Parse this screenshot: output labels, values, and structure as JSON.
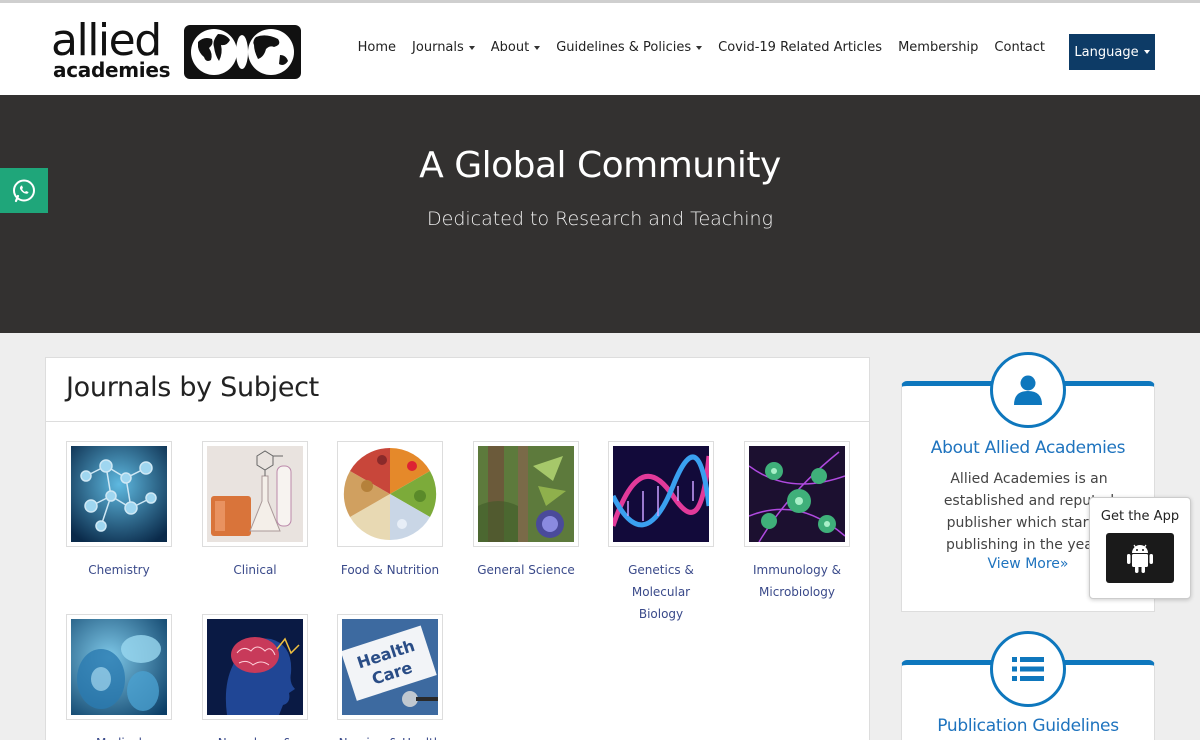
{
  "brand": {
    "logo_word1": "allied",
    "logo_word2": "academies"
  },
  "nav": {
    "items": [
      {
        "label": "Home",
        "dropdown": false
      },
      {
        "label": "Journals",
        "dropdown": true
      },
      {
        "label": "About",
        "dropdown": true
      },
      {
        "label": "Guidelines & Policies",
        "dropdown": true
      },
      {
        "label": "Covid-19 Related Articles",
        "dropdown": false
      },
      {
        "label": "Membership",
        "dropdown": false
      },
      {
        "label": "Contact",
        "dropdown": false
      }
    ],
    "language_label": "Language"
  },
  "hero": {
    "title": "A Global Community",
    "subtitle": "Dedicated to Research and Teaching"
  },
  "subjects": {
    "heading": "Journals by Subject",
    "items": [
      {
        "label": "Chemistry"
      },
      {
        "label": "Clinical"
      },
      {
        "label": "Food & Nutrition"
      },
      {
        "label": "General Science"
      },
      {
        "label": "Genetics & Molecular Biology"
      },
      {
        "label": "Immunology & Microbiology"
      },
      {
        "label": "Medical"
      },
      {
        "label": "Neurology &"
      },
      {
        "label": "Nursing & Health"
      }
    ]
  },
  "sidebar": {
    "about": {
      "title": "About Allied Academies",
      "text": "Allied Academies is an established and reputed publisher which started publishing in the year 1",
      "link": "View More»"
    },
    "guidelines": {
      "title": "Publication Guidelines"
    }
  },
  "app_popup": {
    "label": "Get the App"
  },
  "colors": {
    "accent": "#0e77bd",
    "hero_bg": "#333130",
    "language_bg": "#0d3b66",
    "whatsapp": "#1fa67a"
  }
}
